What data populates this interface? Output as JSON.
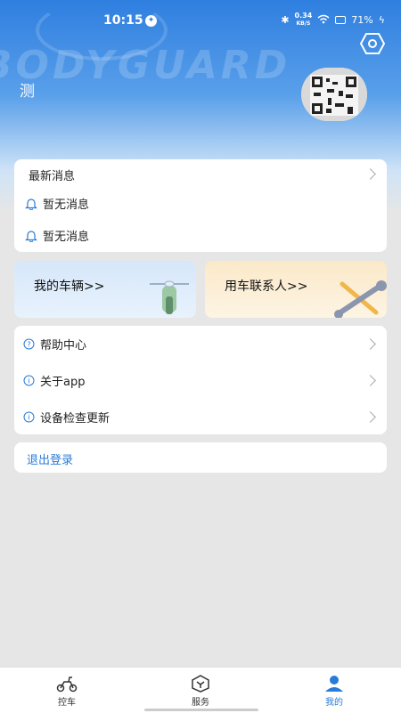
{
  "status_bar": {
    "time": "10:15",
    "net_speed_value": "0.34",
    "net_speed_unit": "KB/S",
    "battery": "71%"
  },
  "profile": {
    "username": "测"
  },
  "news": {
    "title": "最新消息",
    "items": [
      "暂无消息",
      "暂无消息"
    ]
  },
  "quick_cards": {
    "vehicle_label": "我的车辆>>",
    "contacts_label": "用车联系人>>"
  },
  "menu": [
    {
      "label": "帮助中心",
      "icon": "help-icon"
    },
    {
      "label": "关于app",
      "icon": "info-icon"
    },
    {
      "label": "设备检查更新",
      "icon": "info-icon"
    }
  ],
  "logout": {
    "label": "退出登录"
  },
  "tabbar": {
    "tabs": [
      "控车",
      "服务",
      "我的"
    ],
    "active": "我的"
  },
  "colors": {
    "primary": "#2f7fe0",
    "link": "#2a7bd8"
  }
}
